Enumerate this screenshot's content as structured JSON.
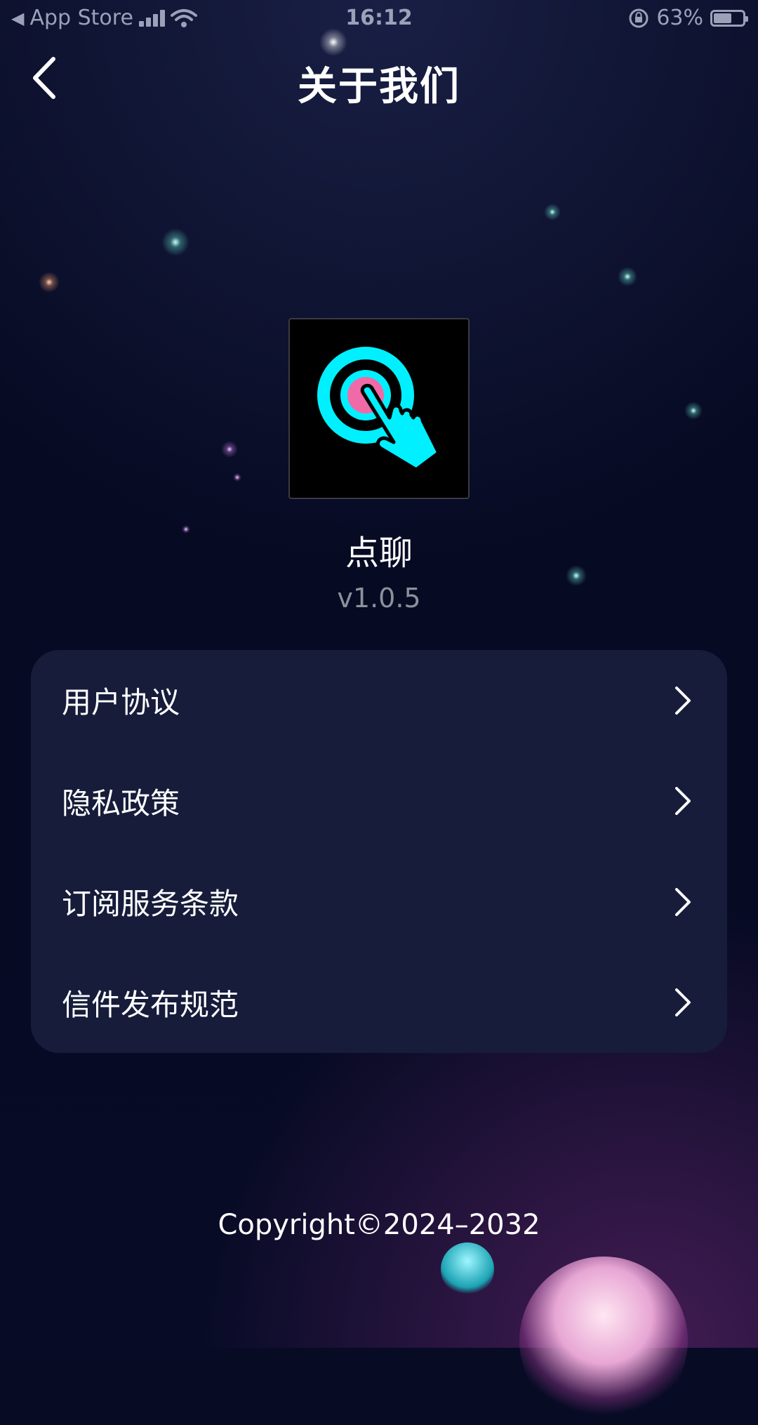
{
  "status_bar": {
    "back_app": "App Store",
    "time": "16:12",
    "battery": "63%",
    "battery_level": 0.63
  },
  "nav": {
    "title": "关于我们",
    "back_icon": "chevron-left-icon"
  },
  "app": {
    "name": "点聊",
    "version": "v1.0.5",
    "icon": "tap-target-hand-icon",
    "icon_colors": {
      "ring": "#00f0ff",
      "center": "#f06aa8",
      "background": "#000000"
    }
  },
  "menu": {
    "items": [
      {
        "label": "用户协议",
        "icon": "chevron-right-icon"
      },
      {
        "label": "隐私政策",
        "icon": "chevron-right-icon"
      },
      {
        "label": "订阅服务条款",
        "icon": "chevron-right-icon"
      },
      {
        "label": "信件发布规范",
        "icon": "chevron-right-icon"
      }
    ]
  },
  "footer": {
    "copyright": "Copyright©2024–2032"
  },
  "colors": {
    "background": "#070b24",
    "card": "#161c3a",
    "text": "#ffffff",
    "muted": "#8d909c"
  }
}
